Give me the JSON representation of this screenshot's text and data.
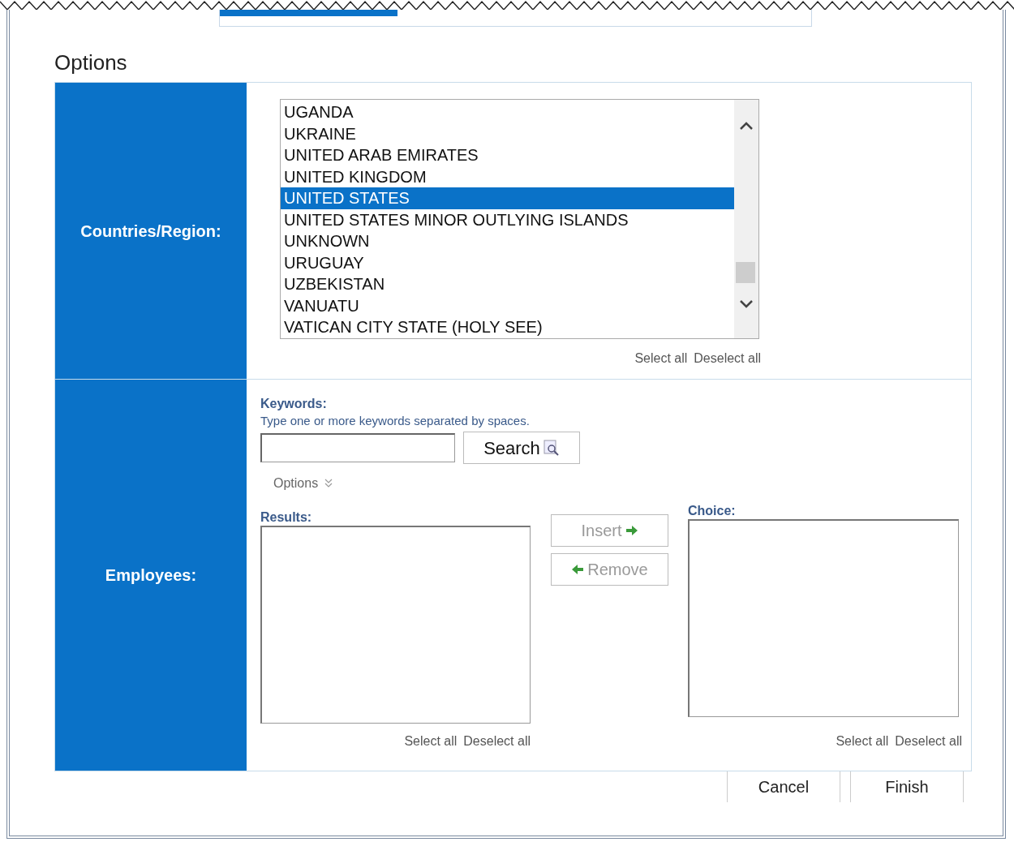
{
  "progress": {
    "level": 0.3
  },
  "title": "Options",
  "countries": {
    "label": "Countries/Region:",
    "items": [
      {
        "text": "UGANDA",
        "selected": false
      },
      {
        "text": "UKRAINE",
        "selected": false
      },
      {
        "text": "UNITED ARAB EMIRATES",
        "selected": false
      },
      {
        "text": "UNITED KINGDOM",
        "selected": false
      },
      {
        "text": "UNITED STATES",
        "selected": true
      },
      {
        "text": "UNITED STATES MINOR OUTLYING ISLANDS",
        "selected": false
      },
      {
        "text": "UNKNOWN",
        "selected": false
      },
      {
        "text": "URUGUAY",
        "selected": false
      },
      {
        "text": "UZBEKISTAN",
        "selected": false
      },
      {
        "text": "VANUATU",
        "selected": false
      },
      {
        "text": "VATICAN CITY STATE (HOLY SEE)",
        "selected": false
      }
    ],
    "select_all": "Select all",
    "deselect_all": "Deselect all"
  },
  "employees": {
    "label": "Employees:",
    "keywords_label": "Keywords:",
    "hint": "Type one or more keywords separated by spaces.",
    "search_button": "Search",
    "options_toggle": "Options",
    "results": {
      "label": "Results:",
      "select_all": "Select all",
      "deselect_all": "Deselect all"
    },
    "insert_button": "Insert",
    "remove_button": "Remove",
    "choice": {
      "label": "Choice:",
      "select_all": "Select all",
      "deselect_all": "Deselect all"
    }
  },
  "buttons": [
    "Cancel",
    "Finish"
  ]
}
